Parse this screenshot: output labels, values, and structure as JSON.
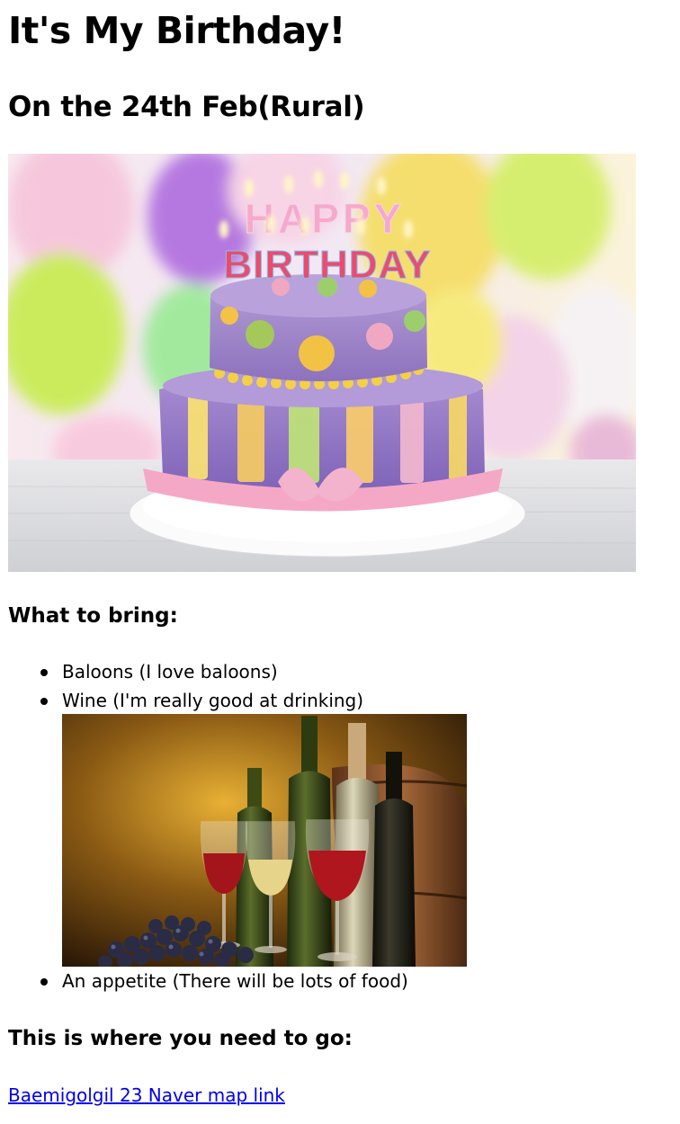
{
  "heading": "It's My Birthday!",
  "subheading": "On the 24th Feb(Rural)",
  "hero_image": {
    "cake_candle_text_top": "HAPPY",
    "cake_candle_text_bottom": "BIRTHDAY"
  },
  "bring": {
    "title": "What to bring:",
    "items": [
      "Baloons (I love baloons)",
      "Wine (I'm really good at drinking)",
      "An appetite (There will be lots of food)"
    ]
  },
  "directions": {
    "title": "This is where you need to go:",
    "link_text": "Baemigolgil 23 Naver map link"
  },
  "colors": {
    "link": "#0000ee",
    "text": "#000000",
    "background": "#ffffff"
  }
}
